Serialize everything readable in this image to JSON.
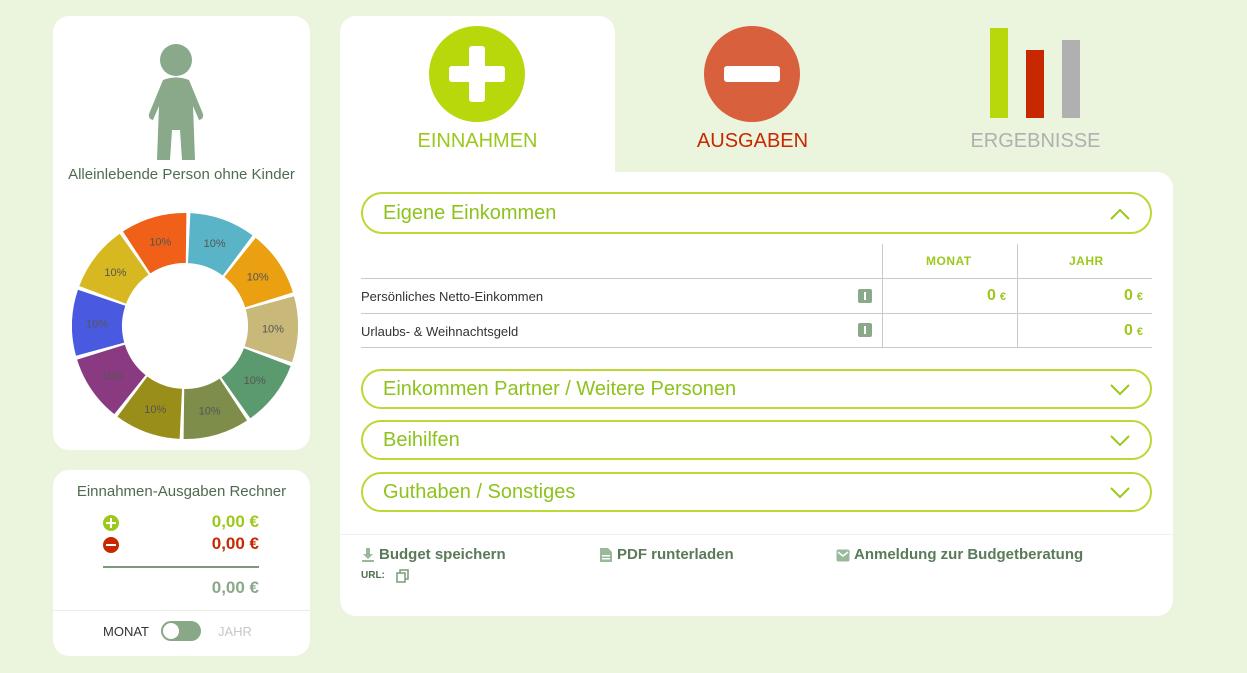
{
  "profile": {
    "label": "Alleinlebende Person ohne Kinder",
    "donut_slices": [
      {
        "label": "10%",
        "color": "#5ab4c8"
      },
      {
        "label": "10%",
        "color": "#eaa010"
      },
      {
        "label": "10%",
        "color": "#c8b87a"
      },
      {
        "label": "10%",
        "color": "#5a9a6e"
      },
      {
        "label": "10%",
        "color": "#7e8e4a"
      },
      {
        "label": "10%",
        "color": "#9a8e1a"
      },
      {
        "label": "10%",
        "color": "#8a3a80"
      },
      {
        "label": "10%",
        "color": "#4a5ae0"
      },
      {
        "label": "10%",
        "color": "#d8b820"
      },
      {
        "label": "10%",
        "color": "#f06018"
      }
    ]
  },
  "calculator": {
    "title": "Einnahmen-Ausgaben Rechner",
    "income_value": "0,00 €",
    "expense_value": "0,00 €",
    "balance_value": "0,00 €",
    "toggle_left": "MONAT",
    "toggle_right": "JAHR"
  },
  "tabs": {
    "income": {
      "label": "EINNAHMEN",
      "color": "#b8d80c"
    },
    "expenses": {
      "label": "AUSGABEN",
      "color": "#d8603c"
    },
    "results": {
      "label": "ERGEBNISSE",
      "color": "#b0b0b0"
    }
  },
  "sections": {
    "own_income": {
      "title": "Eigene Einkommen",
      "expanded": true
    },
    "partner_income": {
      "title": "Einkommen Partner / Weitere Personen",
      "expanded": false
    },
    "benefits": {
      "title": "Beihilfen",
      "expanded": false
    },
    "other": {
      "title": "Guthaben / Sonstiges",
      "expanded": false
    }
  },
  "income_table": {
    "col_month": "MONAT",
    "col_year": "JAHR",
    "rows": [
      {
        "label": "Persönliches Netto-Einkommen",
        "month": "0",
        "year": "0",
        "currency": "€"
      },
      {
        "label": "Urlaubs- & Weihnachtsgeld",
        "month": "",
        "year": "0",
        "currency": "€"
      }
    ]
  },
  "footer": {
    "save_label": "Budget speichern",
    "pdf_label": "PDF runterladen",
    "register_label": "Anmeldung zur Budgetberatung",
    "url_label": "URL:"
  },
  "colors": {
    "accent_green": "#9cc81c",
    "expense_red": "#c82800",
    "muted_green": "#88a888"
  }
}
